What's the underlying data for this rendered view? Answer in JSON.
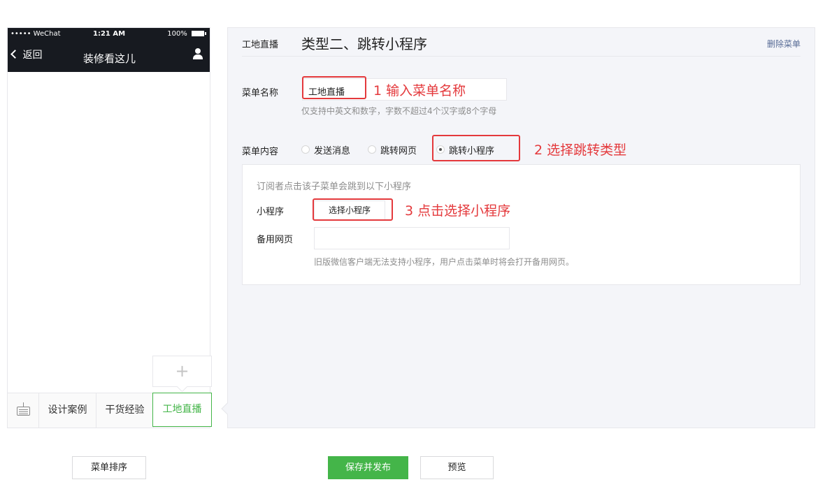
{
  "phone": {
    "status": {
      "carrier": "••••• WeChat",
      "time": "1:21 AM",
      "battery": "100%"
    },
    "nav": {
      "back": "返回",
      "account_name": "装修看这儿"
    },
    "add_button": "+",
    "menu_tabs": [
      {
        "label": "设计案例",
        "active": false
      },
      {
        "label": "干货经验",
        "active": false
      },
      {
        "label": "工地直播",
        "active": true
      }
    ]
  },
  "editor": {
    "header": {
      "menu_name": "工地直播",
      "title": "类型二、跳转小程序",
      "delete_link": "删除菜单"
    },
    "name_field": {
      "label": "菜单名称",
      "value": "工地直播",
      "hint": "仅支持中英文和数字，字数不超过4个汉字或8个字母"
    },
    "content": {
      "label": "菜单内容",
      "options": [
        {
          "label": "发送消息",
          "checked": false
        },
        {
          "label": "跳转网页",
          "checked": false
        },
        {
          "label": "跳转小程序",
          "checked": true
        }
      ]
    },
    "miniprogram": {
      "intro": "订阅者点击该子菜单会跳到以下小程序",
      "mp_label": "小程序",
      "select_button": "选择小程序",
      "backup_label": "备用网页",
      "backup_value": "",
      "backup_hint": "旧版微信客户端无法支持小程序，用户点击菜单时将会打开备用网页。"
    }
  },
  "annotations": {
    "step1": "1 输入菜单名称",
    "step2": "2 选择跳转类型",
    "step3": "3 点击选择小程序"
  },
  "footer": {
    "sort_button": "菜单排序",
    "publish_button": "保存并发布",
    "preview_button": "预览"
  },
  "colors": {
    "accent_green": "#44b549",
    "annotation_red": "#e4393c",
    "link_blue": "#576b95"
  }
}
